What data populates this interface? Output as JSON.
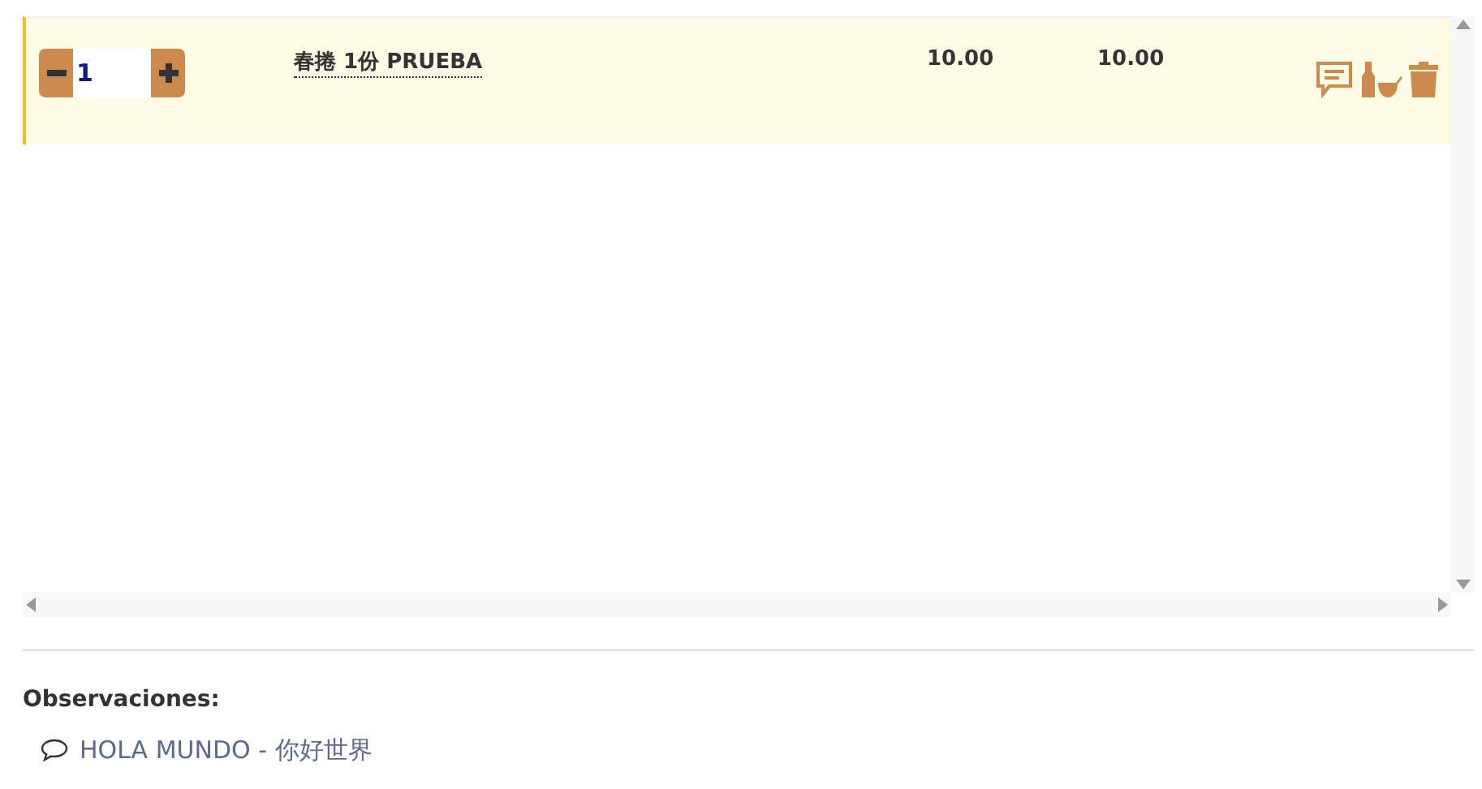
{
  "order_lines": [
    {
      "selected": true,
      "quantity": "1",
      "name": "春捲 1份 PRUEBA",
      "unit_price": "10.00",
      "total": "10.00"
    }
  ],
  "observations": {
    "label": "Observaciones:",
    "value": "HOLA MUNDO - 你好世界"
  }
}
